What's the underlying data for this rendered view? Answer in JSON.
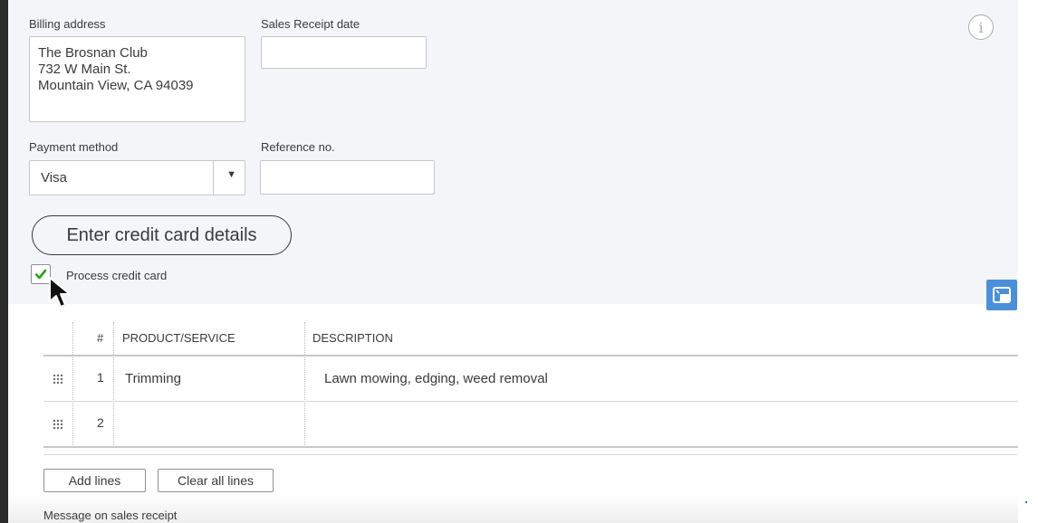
{
  "form": {
    "billing_address_label": "Billing address",
    "billing_address_lines": [
      "The Brosnan Club",
      "732 W Main St.",
      "Mountain View, CA 94039"
    ],
    "sales_receipt_date_label": "Sales Receipt date",
    "sales_receipt_date_value": "",
    "payment_method_label": "Payment method",
    "payment_method_value": "Visa",
    "reference_no_label": "Reference no.",
    "reference_no_value": "",
    "enter_cc_button": "Enter credit card details",
    "process_cc_label": "Process credit card",
    "process_cc_checked": true
  },
  "table": {
    "headers": {
      "num": "#",
      "product": "PRODUCT/SERVICE",
      "description": "DESCRIPTION"
    },
    "rows": [
      {
        "num": "1",
        "product": "Trimming",
        "description": "Lawn mowing, edging, weed removal"
      },
      {
        "num": "2",
        "product": "",
        "description": ""
      }
    ]
  },
  "actions": {
    "add_lines": "Add lines",
    "clear_all_lines": "Clear all lines"
  },
  "message_label": "Message on sales receipt",
  "icons": {
    "info": "info-icon",
    "float": "picture-in-picture-icon",
    "drag": "drag-handle-icon",
    "check": "checkmark-icon",
    "caret": "caret-down-icon",
    "cursor": "mouse-pointer-icon"
  },
  "colors": {
    "panel_bg": "#f4f5f8",
    "check_green": "#2ca01c",
    "float_blue": "#4a90d9"
  }
}
